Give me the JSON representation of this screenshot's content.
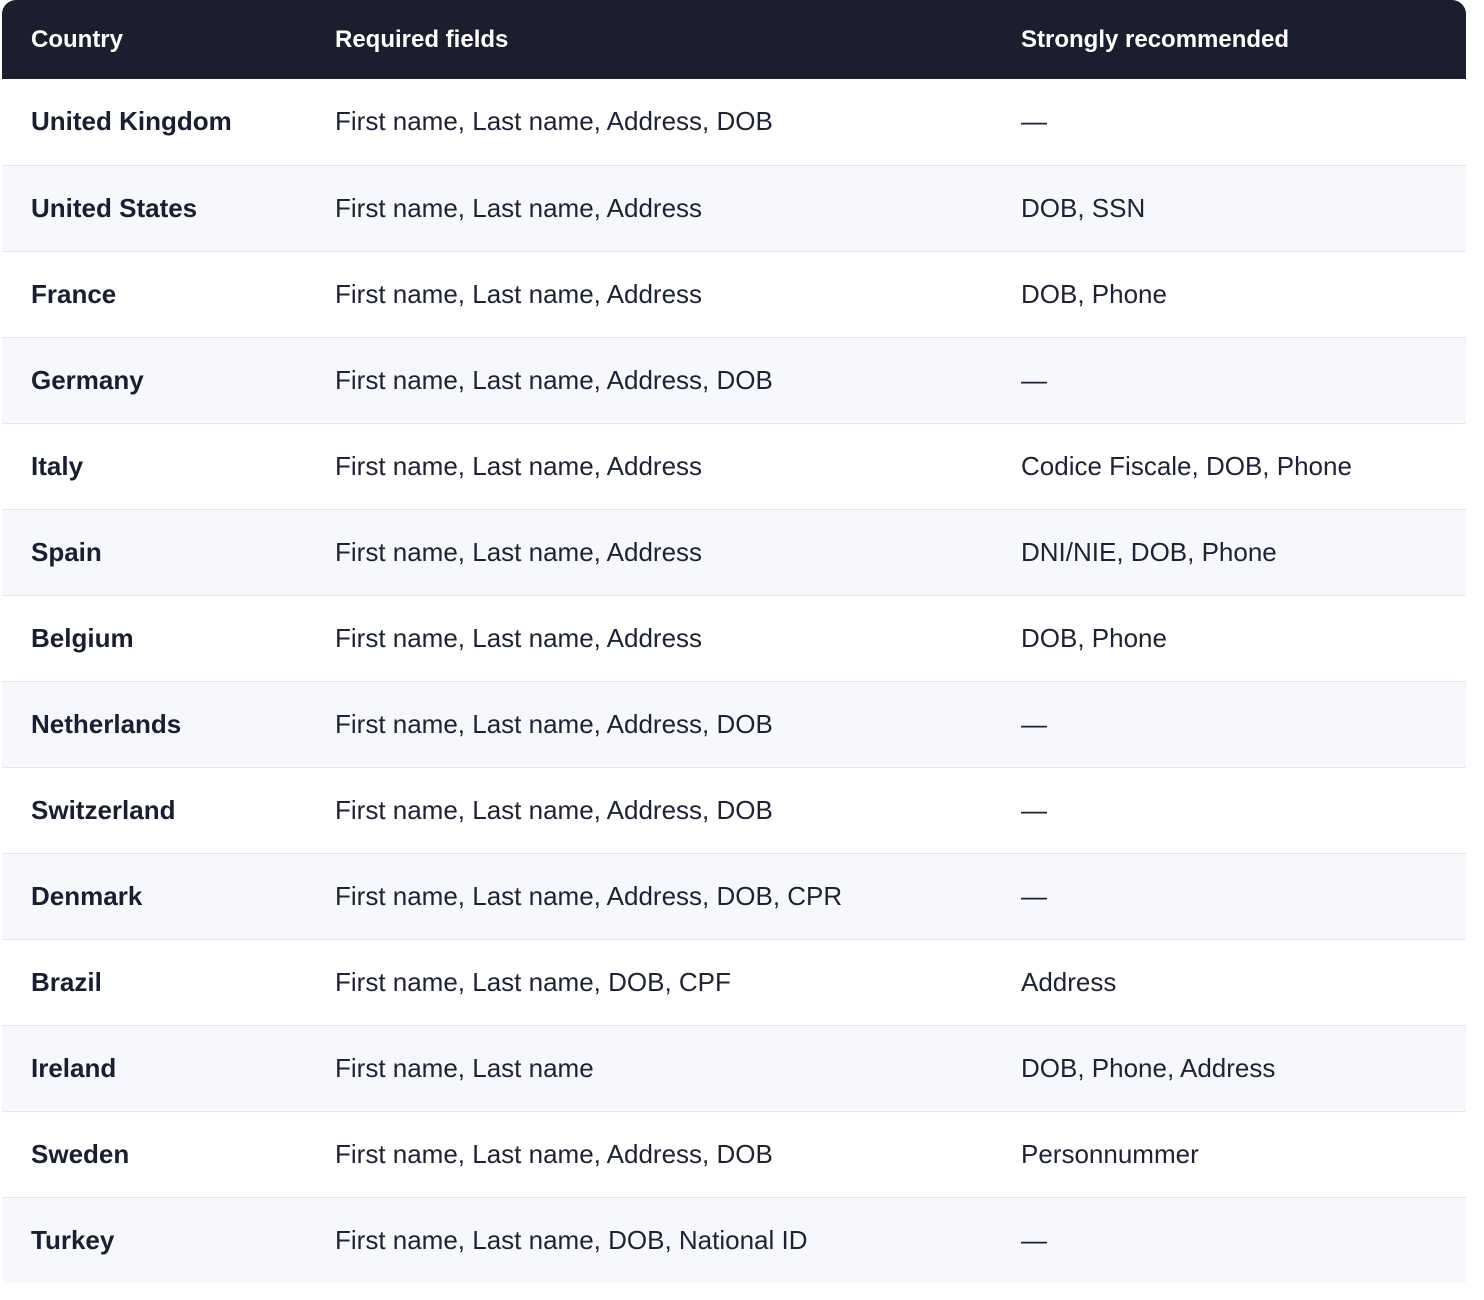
{
  "table": {
    "headers": [
      "Country",
      "Required fields",
      "Strongly recommended"
    ],
    "rows": [
      {
        "country": "United Kingdom",
        "required": "First name, Last name, Address, DOB",
        "recommended": "—"
      },
      {
        "country": "United States",
        "required": "First name, Last name, Address",
        "recommended": "DOB, SSN"
      },
      {
        "country": "France",
        "required": "First name, Last name, Address",
        "recommended": "DOB, Phone"
      },
      {
        "country": "Germany",
        "required": "First name, Last name, Address, DOB",
        "recommended": "—"
      },
      {
        "country": "Italy",
        "required": "First name, Last name, Address",
        "recommended": "Codice Fiscale, DOB, Phone"
      },
      {
        "country": "Spain",
        "required": "First name, Last name, Address",
        "recommended": "DNI/NIE, DOB, Phone"
      },
      {
        "country": "Belgium",
        "required": "First name, Last name, Address",
        "recommended": "DOB, Phone"
      },
      {
        "country": "Netherlands",
        "required": "First name, Last name, Address, DOB",
        "recommended": "—"
      },
      {
        "country": "Switzerland",
        "required": "First name, Last name, Address, DOB",
        "recommended": "—"
      },
      {
        "country": "Denmark",
        "required": "First name, Last name, Address, DOB, CPR",
        "recommended": "—"
      },
      {
        "country": "Brazil",
        "required": "First name, Last name, DOB, CPF",
        "recommended": "Address"
      },
      {
        "country": "Ireland",
        "required": "First name, Last name",
        "recommended": "DOB, Phone, Address"
      },
      {
        "country": "Sweden",
        "required": "First name, Last name, Address, DOB",
        "recommended": "Personnummer"
      },
      {
        "country": "Turkey",
        "required": "First name, Last name, DOB, National ID",
        "recommended": "—"
      }
    ]
  }
}
